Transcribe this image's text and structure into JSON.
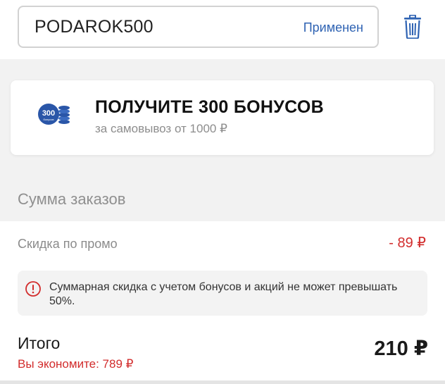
{
  "promo": {
    "code": "PODAROK500",
    "status": "Применен",
    "delete_icon": "trash-icon"
  },
  "bonus_card": {
    "badge_text": "300",
    "badge_caption": "бонусов",
    "title": "ПОЛУЧИТЕ 300 БОНУСОВ",
    "subtitle": "за самовывоз от 1000 ₽",
    "accent_color": "#2a56a8"
  },
  "summary": {
    "section_title": "Сумма заказов",
    "discount_label": "Скидка по промо",
    "discount_value": "- 89 ₽",
    "warning_icon": "alert-circle-icon",
    "warning_text": "Суммарная скидка с учетом бонусов и акций не может превышать 50%.",
    "total_label": "Итого",
    "total_value": "210 ₽",
    "savings_text": "Вы экономите: 789 ₽",
    "negative_color": "#d22c2c"
  }
}
